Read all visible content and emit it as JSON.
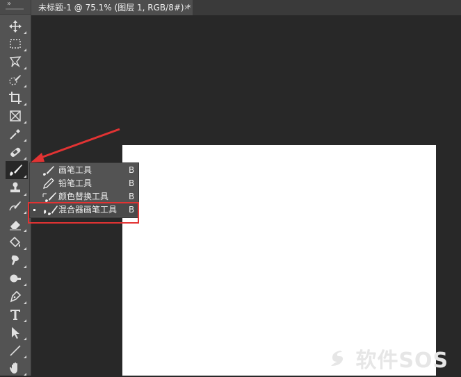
{
  "document_tab": {
    "title": "未标题-1 @ 75.1% (图层 1, RGB/8#) *",
    "close_glyph": "×"
  },
  "toolbar": {
    "grip_glyph": "»",
    "tools": [
      {
        "name": "move-icon"
      },
      {
        "name": "marquee-icon"
      },
      {
        "name": "lasso-icon"
      },
      {
        "name": "quick-selection-icon"
      },
      {
        "name": "crop-icon"
      },
      {
        "name": "frame-icon"
      },
      {
        "name": "eyedropper-icon"
      },
      {
        "name": "healing-brush-icon"
      },
      {
        "name": "brush-icon",
        "active": true
      },
      {
        "name": "clone-stamp-icon"
      },
      {
        "name": "history-brush-icon"
      },
      {
        "name": "eraser-icon"
      },
      {
        "name": "paint-bucket-icon"
      },
      {
        "name": "smudge-icon"
      },
      {
        "name": "dodge-icon"
      },
      {
        "name": "pen-icon"
      },
      {
        "name": "type-icon"
      },
      {
        "name": "path-selection-icon"
      },
      {
        "name": "line-icon"
      },
      {
        "name": "hand-icon"
      }
    ]
  },
  "flyout": {
    "items": [
      {
        "label": "画笔工具",
        "key": "B",
        "icon": "brush-icon"
      },
      {
        "label": "铅笔工具",
        "key": "B",
        "icon": "pencil-icon"
      },
      {
        "label": "颜色替换工具",
        "key": "B",
        "icon": "color-replacement-icon"
      },
      {
        "label": "混合器画笔工具",
        "key": "B",
        "icon": "mixer-brush-icon",
        "selected": true
      }
    ]
  },
  "watermark": {
    "text": "软件SOS"
  },
  "colors": {
    "toolbar_bg": "#535353",
    "workspace_bg": "#282828",
    "canvas_bg": "#ffffff",
    "highlight": "#e23333"
  }
}
